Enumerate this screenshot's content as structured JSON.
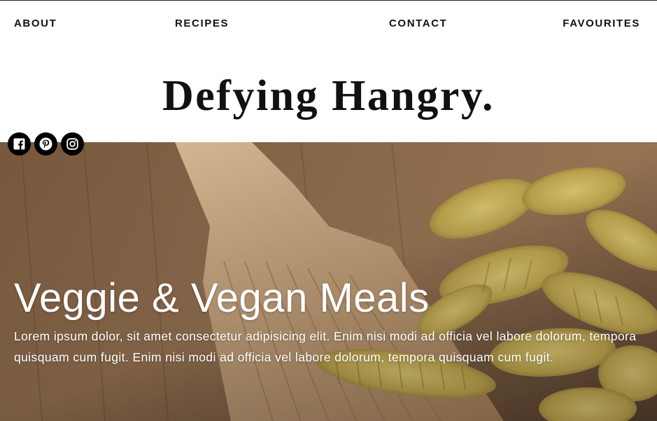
{
  "nav": {
    "about": "ABOUT",
    "recipes": "RECIPES",
    "contact": "CONTACT",
    "favourites": "FAVOURITES"
  },
  "brand": {
    "title": "Defying Hangry."
  },
  "social": [
    {
      "icon": "facebook-icon"
    },
    {
      "icon": "pinterest-icon"
    },
    {
      "icon": "instagram-icon"
    }
  ],
  "hero": {
    "title": "Veggie & Vegan Meals",
    "text": "Lorem ipsum dolor, sit amet consectetur adipisicing elit. Enim nisi modi ad officia vel labore dolorum, tempora quisquam cum fugit. Enim nisi modi ad officia vel labore dolorum, tempora quisquam cum fugit."
  },
  "colors": {
    "text": "#111111",
    "hero_text": "#ffffff",
    "social_bg": "#000000"
  }
}
